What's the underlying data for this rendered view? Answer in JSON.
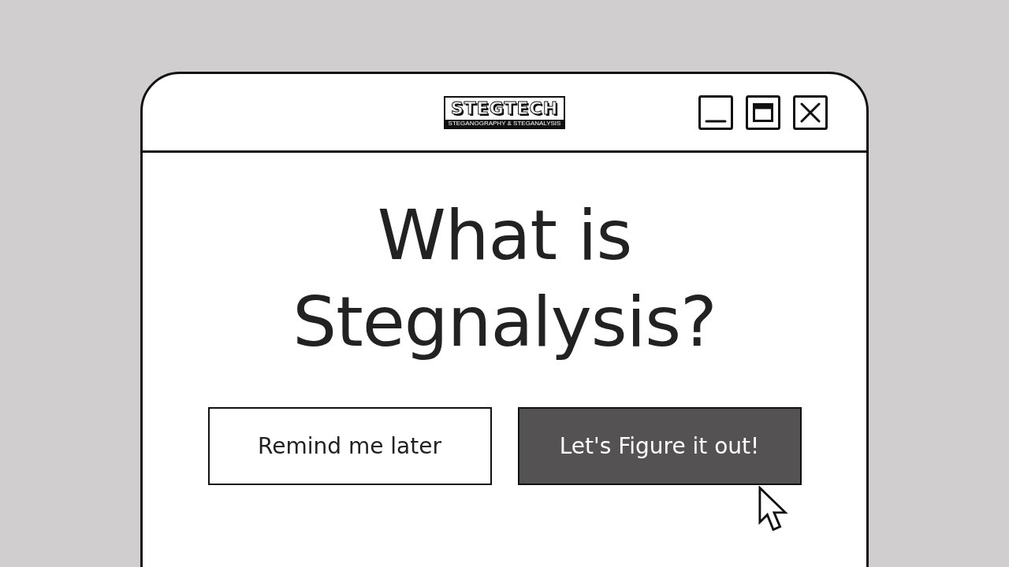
{
  "window": {
    "logo": {
      "title": "STEGTECH",
      "tagline": "STEGANOGRAPHY & STEGANALYSIS"
    },
    "controls": [
      {
        "kind": "minimize"
      },
      {
        "kind": "maximize"
      },
      {
        "kind": "close"
      }
    ]
  },
  "heading": "What is Stegnalysis?",
  "buttons": [
    {
      "label": "Remind me later",
      "kind": "outline"
    },
    {
      "label": "Let's Figure it out!",
      "kind": "filled"
    }
  ]
}
